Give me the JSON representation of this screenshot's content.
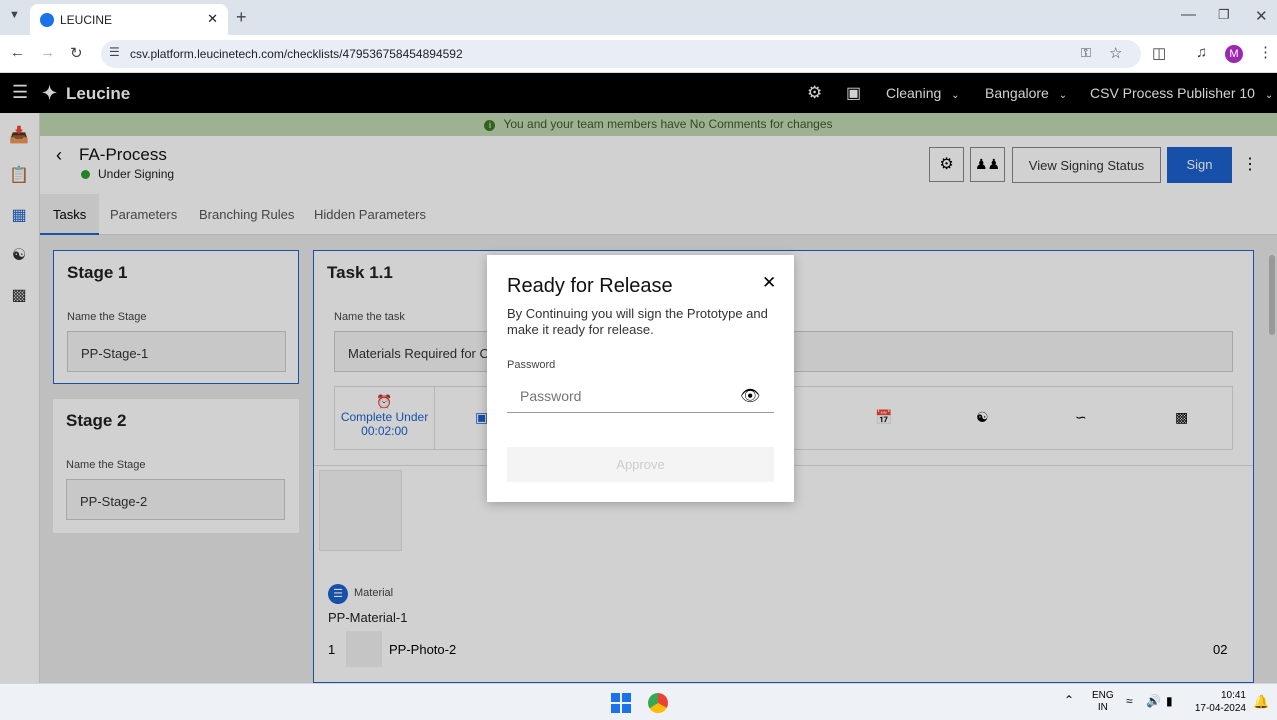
{
  "browser": {
    "tab_title": "LEUCINE",
    "url": "csv.platform.leucinetech.com/checklists/479536758454894592",
    "profile_initial": "M"
  },
  "header": {
    "brand": "Leucine",
    "facility_1": "Cleaning",
    "facility_2": "Bangalore",
    "user": "CSV Process Publisher 10"
  },
  "banner": {
    "text": "You and your team members have No Comments for changes"
  },
  "process": {
    "name": "FA-Process",
    "status": "Under Signing",
    "view_signing_label": "View Signing Status",
    "sign_label": "Sign"
  },
  "tabs": [
    "Tasks",
    "Parameters",
    "Branching Rules",
    "Hidden Parameters"
  ],
  "stages": [
    {
      "title": "Stage 1",
      "field_label": "Name the Stage",
      "value": "PP-Stage-1"
    },
    {
      "title": "Stage 2",
      "field_label": "Name the Stage",
      "value": "PP-Stage-2"
    }
  ],
  "task": {
    "title": "Task 1.1",
    "field_label": "Name the task",
    "value": "Materials Required for C",
    "timer_label": "Complete Under",
    "timer_value": "00:02:00",
    "material_label": "Material",
    "material_name": "PP-Material-1",
    "row_index": "1",
    "photo_name": "PP-Photo-2",
    "quantity": "02"
  },
  "modal": {
    "title": "Ready for Release",
    "description": "By Continuing you will sign the Prototype and make it ready for release.",
    "password_label": "Password",
    "password_placeholder": "Password",
    "approve_label": "Approve"
  },
  "taskbar": {
    "lang_1": "ENG",
    "lang_2": "IN",
    "time": "10:41",
    "date": "17-04-2024"
  },
  "colors": {
    "primary": "#1d62ce",
    "status_dot": "#2e9e2e",
    "banner": "#c2d8b4"
  }
}
